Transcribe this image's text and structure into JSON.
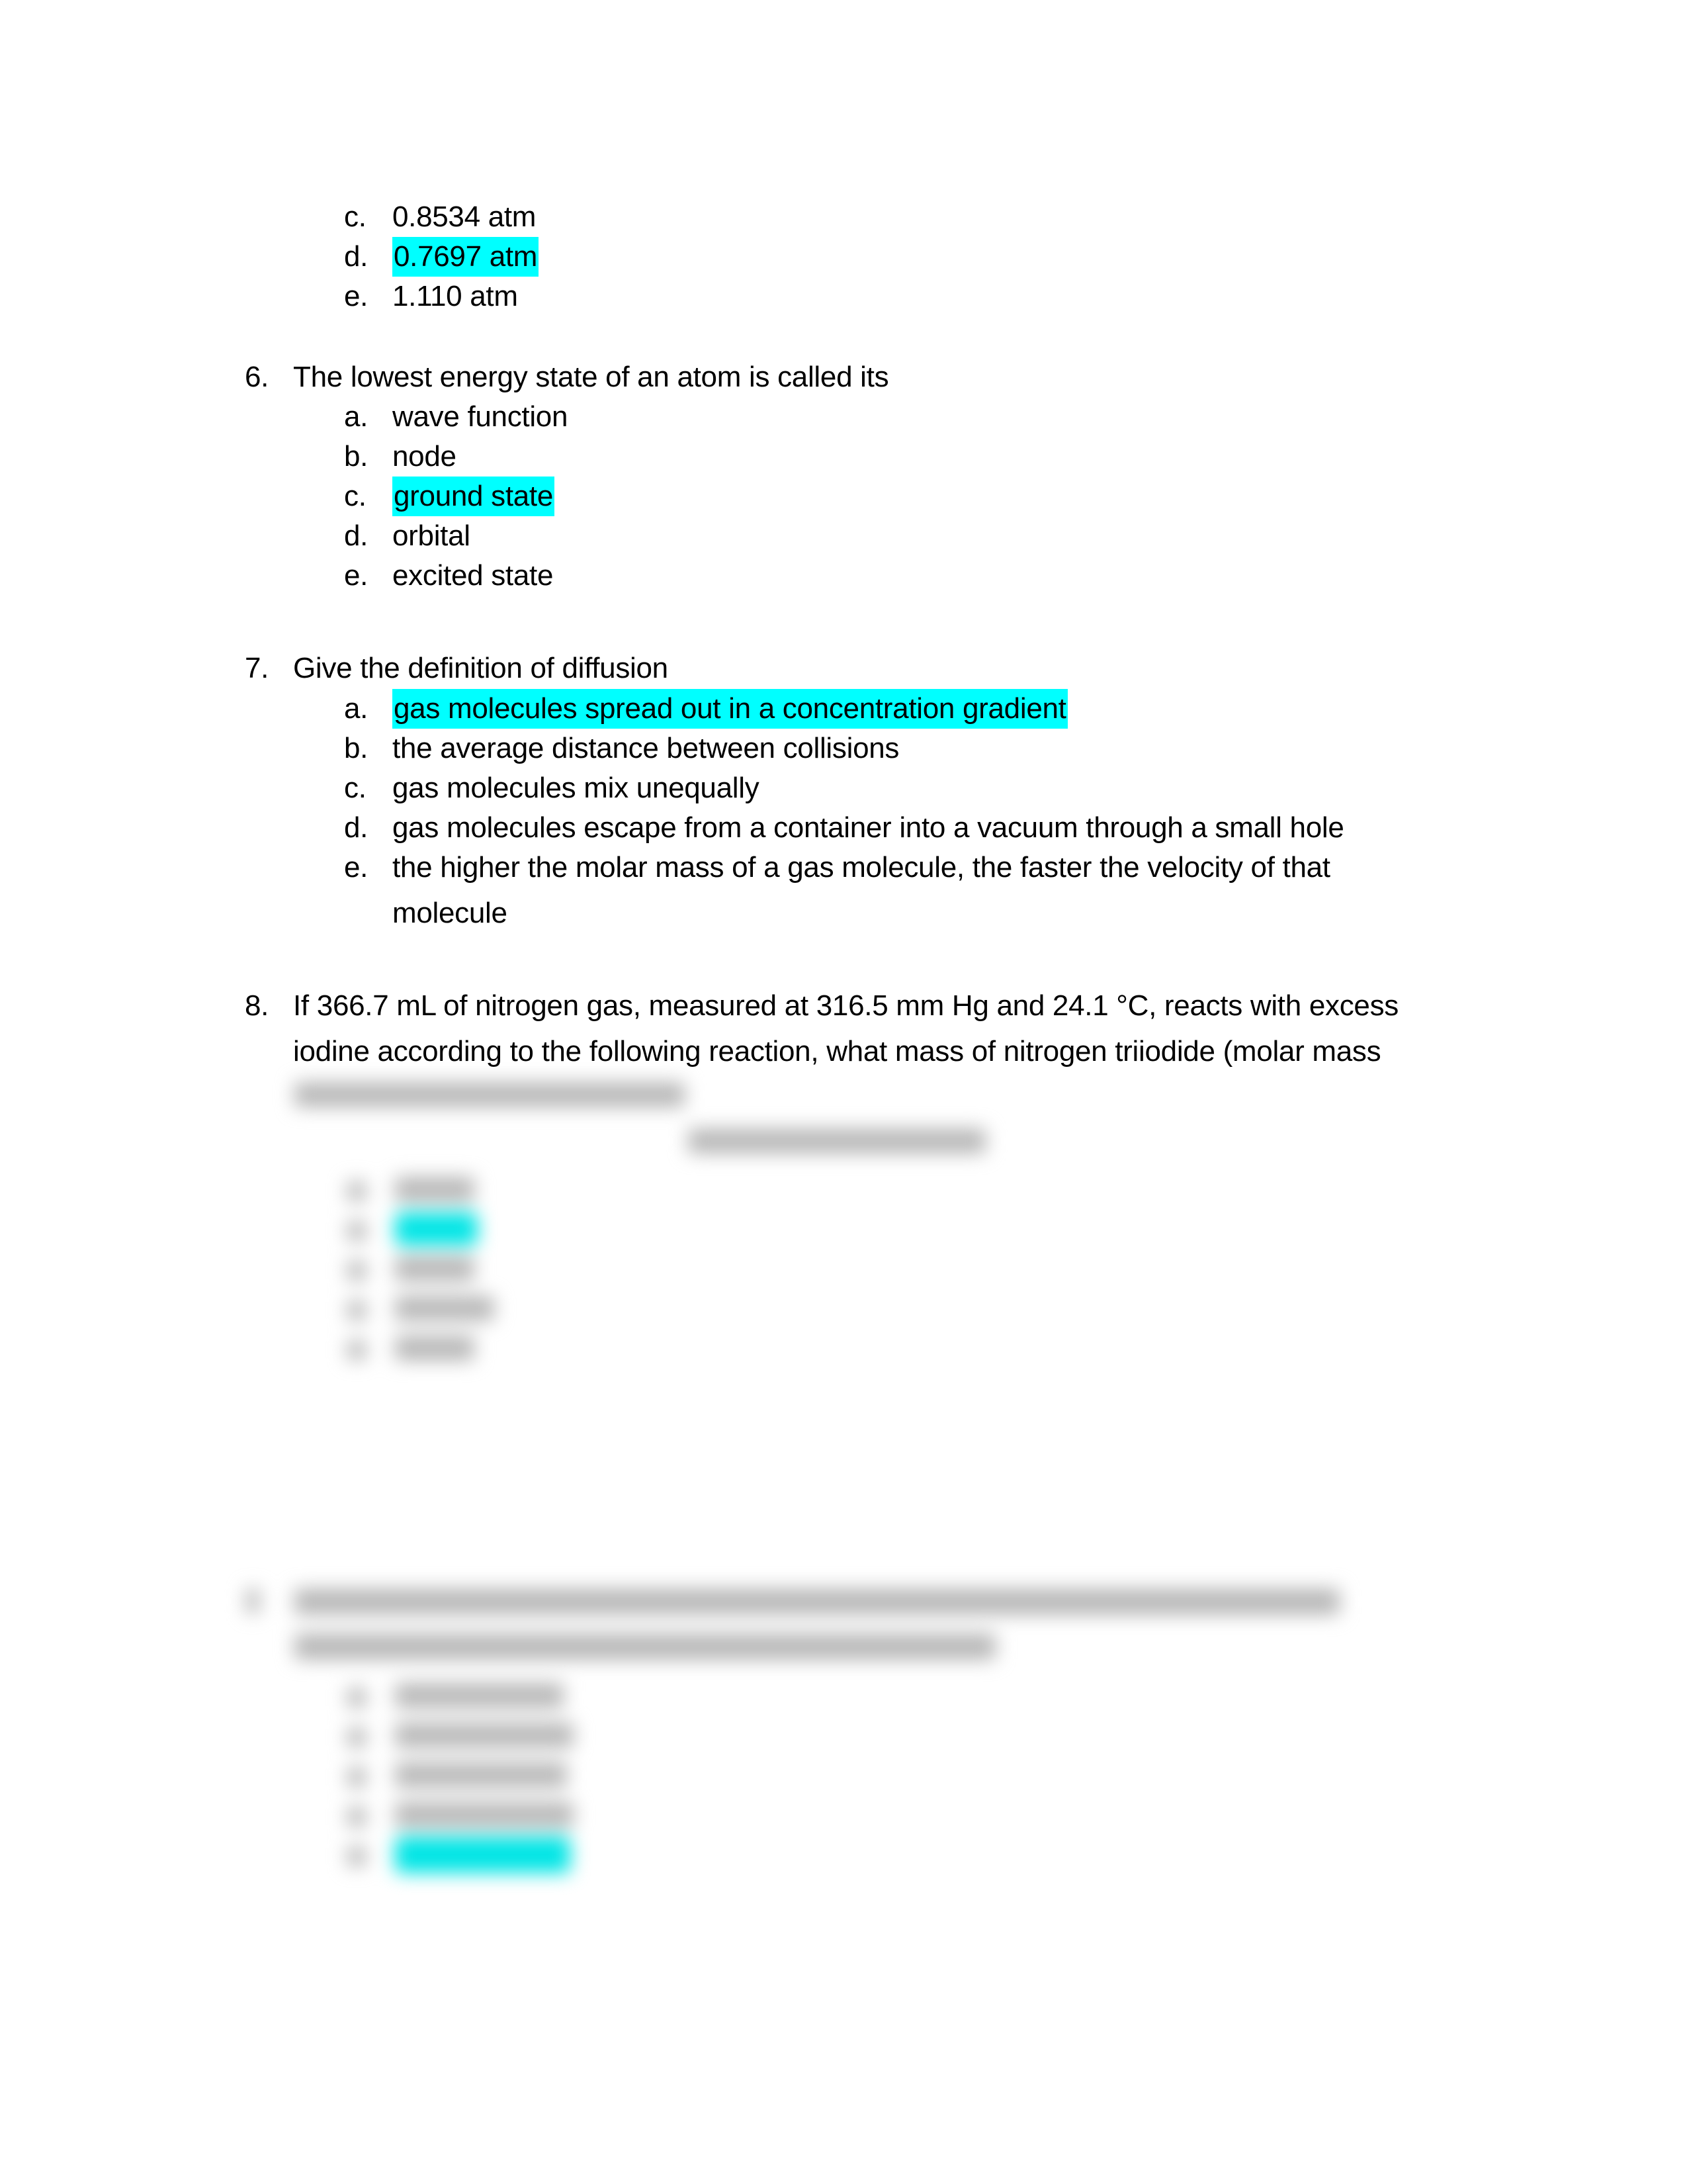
{
  "document": {
    "continued_question": {
      "options": [
        {
          "letter": "c.",
          "text": "0.8534 atm",
          "highlighted": false
        },
        {
          "letter": "d.",
          "text": "0.7697 atm",
          "highlighted": true
        },
        {
          "letter": "e.",
          "text": "1.110 atm",
          "highlighted": false
        }
      ]
    },
    "questions": [
      {
        "number": "6.",
        "lines": [
          "The lowest energy state of an atom is called its"
        ],
        "options": [
          {
            "letter": "a.",
            "text": "wave function",
            "highlighted": false
          },
          {
            "letter": "b.",
            "text": "node",
            "highlighted": false
          },
          {
            "letter": "c.",
            "text": "ground state",
            "highlighted": true
          },
          {
            "letter": "d.",
            "text": "orbital",
            "highlighted": false
          },
          {
            "letter": "e.",
            "text": "excited state",
            "highlighted": false
          }
        ]
      },
      {
        "number": "7.",
        "lines": [
          "Give the definition of diffusion"
        ],
        "options": [
          {
            "letter": "a.",
            "text": "gas molecules spread out in a concentration gradient",
            "highlighted": true
          },
          {
            "letter": "b.",
            "text": "the average distance between collisions",
            "highlighted": false
          },
          {
            "letter": "c.",
            "text": "gas molecules mix unequally",
            "highlighted": false
          },
          {
            "letter": "d.",
            "text": "gas molecules escape from a container into a vacuum through a small hole",
            "highlighted": false
          },
          {
            "letter": "e.",
            "text": "the higher the molar mass of a gas molecule, the faster the velocity of that",
            "text_cont": "molecule",
            "highlighted": false
          }
        ]
      },
      {
        "number": "8.",
        "lines": [
          "If 366.7 mL of nitrogen gas, measured at 316.5 mm Hg and 24.1 °C, reacts with excess",
          "iodine according to the following reaction, what mass of nitrogen triiodide (molar mass"
        ],
        "blurred_content": true,
        "highlighted_option_index": 1
      },
      {
        "number": "9.",
        "blurred_content": true,
        "highlighted_option_index": 4
      }
    ],
    "highlight_color": "#00ffff"
  }
}
